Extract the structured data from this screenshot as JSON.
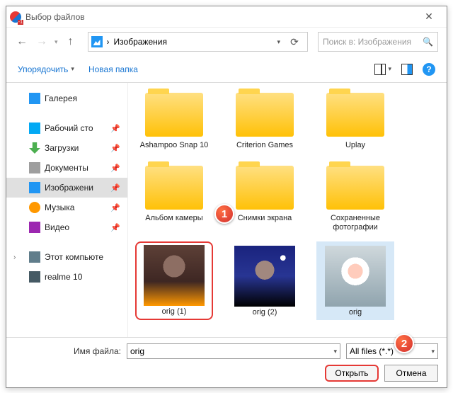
{
  "title": "Выбор файлов",
  "breadcrumb": "Изображения",
  "search_placeholder": "Поиск в: Изображения",
  "toolbar": {
    "organize": "Упорядочить",
    "new_folder": "Новая папка"
  },
  "sidebar": [
    {
      "label": "Галерея",
      "ico": "ico-gal"
    },
    {
      "label": "Рабочий сто",
      "ico": "ico-desk",
      "pin": true
    },
    {
      "label": "Загрузки",
      "ico": "ico-down",
      "pin": true
    },
    {
      "label": "Документы",
      "ico": "ico-doc",
      "pin": true
    },
    {
      "label": "Изображени",
      "ico": "ico-gal",
      "pin": true,
      "sel": true
    },
    {
      "label": "Музыка",
      "ico": "ico-mus",
      "pin": true
    },
    {
      "label": "Видео",
      "ico": "ico-vid",
      "pin": true
    }
  ],
  "sidebar2": [
    {
      "label": "Этот компьюте",
      "ico": "ico-pc",
      "caret": true
    },
    {
      "label": "realme 10",
      "ico": "ico-ph"
    }
  ],
  "folders": [
    {
      "label": "Ashampoo Snap 10"
    },
    {
      "label": "Criterion Games"
    },
    {
      "label": "Uplay"
    },
    {
      "label": "Альбом камеры"
    },
    {
      "label": "Снимки экрана"
    },
    {
      "label": "Сохраненные фотографии"
    }
  ],
  "files": [
    {
      "label": "orig (1)",
      "cls": "cat1",
      "hl": true
    },
    {
      "label": "orig (2)",
      "cls": "cat2"
    },
    {
      "label": "orig",
      "cls": "cat3",
      "sel": true
    }
  ],
  "footer": {
    "name_label": "Имя файла:",
    "name_value": "orig",
    "filter": "All files (*.*)",
    "open": "Открыть",
    "cancel": "Отмена"
  },
  "badges": {
    "b1": "1",
    "b2": "2"
  }
}
